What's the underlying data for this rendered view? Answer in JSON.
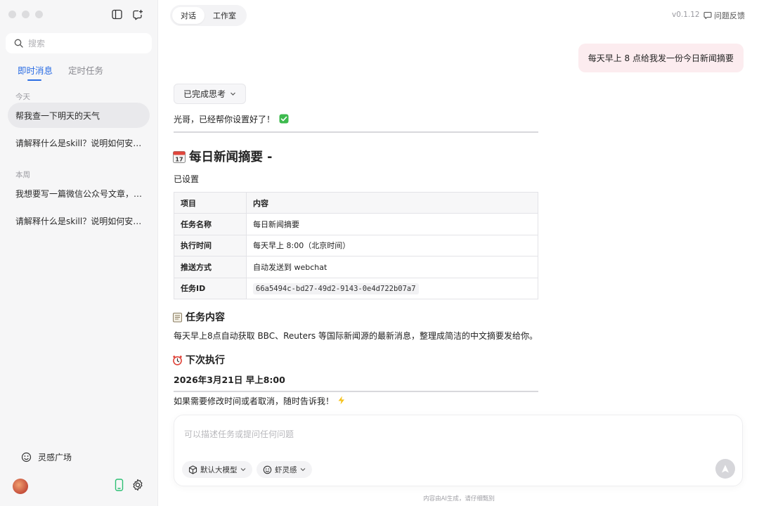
{
  "sidebar": {
    "search_placeholder": "搜索",
    "tabs": [
      {
        "label": "即时消息",
        "active": true
      },
      {
        "label": "定时任务",
        "active": false
      }
    ],
    "groups": [
      {
        "label": "今天",
        "items": [
          "帮我查一下明天的天气",
          "请解释什么是skill？说明如何安装和使用"
        ]
      },
      {
        "label": "本周",
        "items": [
          "我想要写一篇微信公众号文章，主题是",
          "请解释什么是skill？说明如何安装和使用"
        ]
      }
    ],
    "inspiration_label": "灵感广场"
  },
  "header": {
    "tabs": [
      {
        "label": "对话",
        "active": true
      },
      {
        "label": "工作室",
        "active": false
      }
    ],
    "version": "v0.1.12",
    "feedback_label": "问题反馈"
  },
  "conversation": {
    "user_message": "每天早上 8 点给我发一份今日新闻摘要",
    "thought_toggle": "已完成思考",
    "reply_intro": "光哥，已经帮你设置好了！",
    "heading": "每日新闻摘要 -",
    "status_line": "已设置",
    "table": {
      "headers": [
        "项目",
        "内容"
      ],
      "rows": [
        {
          "key": "任务名称",
          "value": "每日新闻摘要"
        },
        {
          "key": "执行时间",
          "value": "每天早上 8:00（北京时间）"
        },
        {
          "key": "推送方式",
          "value": "自动发送到 webchat"
        },
        {
          "key": "任务ID",
          "value": "66a5494c-bd27-49d2-9143-0e4d722b07a7"
        }
      ]
    },
    "task_heading": "任务内容",
    "task_body": "每天早上8点自动获取 BBC、Reuters 等国际新闻源的最新消息，整理成简洁的中文摘要发给你。",
    "next_heading": "下次执行",
    "next_time": "2026年3月21日 早上8:00",
    "closing": "如果需要修改时间或者取消，随时告诉我！"
  },
  "composer": {
    "placeholder": "可以描述任务或提问任何问题",
    "model_label": "默认大模型",
    "inspire_label": "虾灵感"
  },
  "footer": {
    "disclaimer": "内容由AI生成，请仔细甄别"
  },
  "colors": {
    "accent": "#2b6de4",
    "user_bubble": "#fcecef",
    "sidebar_bg": "#f6f6f7"
  }
}
